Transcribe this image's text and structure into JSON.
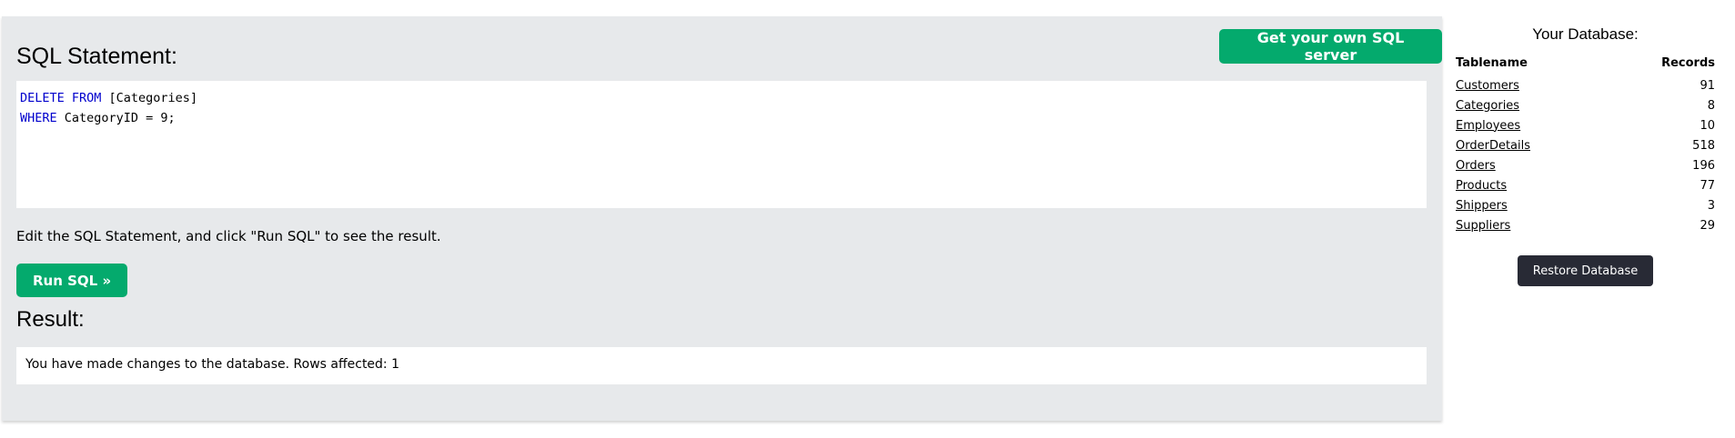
{
  "editor": {
    "heading": "SQL Statement:",
    "get_server_label": "Get your own SQL server",
    "code_line1_kw": "DELETE FROM",
    "code_line1_rest": " [Categories]",
    "code_line2_kw": "WHERE",
    "code_line2_rest": " CategoryID = 9;",
    "instructions": "Edit the SQL Statement, and click \"Run SQL\" to see the result.",
    "run_label": "Run SQL »"
  },
  "result": {
    "heading": "Result:",
    "message": "You have made changes to the database. Rows affected: 1"
  },
  "sidebar": {
    "title": "Your Database:",
    "col_table": "Tablename",
    "col_records": "Records",
    "rows": [
      {
        "name": "Customers",
        "records": "91"
      },
      {
        "name": "Categories",
        "records": "8"
      },
      {
        "name": "Employees",
        "records": "10"
      },
      {
        "name": "OrderDetails",
        "records": "518"
      },
      {
        "name": "Orders",
        "records": "196"
      },
      {
        "name": "Products",
        "records": "77"
      },
      {
        "name": "Shippers",
        "records": "3"
      },
      {
        "name": "Suppliers",
        "records": "29"
      }
    ],
    "restore_label": "Restore Database"
  },
  "colors": {
    "green": "#04aa6d",
    "panel": "#e7e9eb",
    "keyword": "#0000cd",
    "dark_button": "#282a35"
  }
}
